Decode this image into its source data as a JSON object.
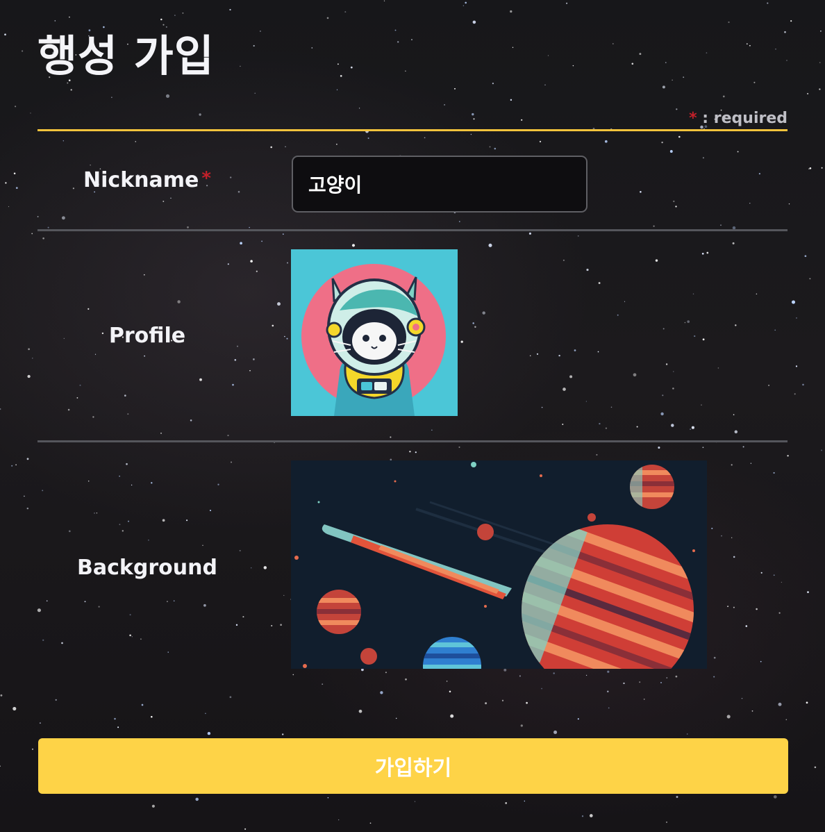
{
  "header": {
    "title": "행성 가입",
    "required_star": "*",
    "required_text": " : required"
  },
  "form": {
    "nickname": {
      "label": "Nickname",
      "required_star": "*",
      "value": "고양이"
    },
    "profile": {
      "label": "Profile",
      "image_icon": "astronaut-cat-icon"
    },
    "background": {
      "label": "Background",
      "image_icon": "space-planets-illustration"
    }
  },
  "submit": {
    "label": "가입하기"
  },
  "colors": {
    "accent_yellow": "#fed347",
    "divider_yellow": "#f3c33c",
    "required_red": "#c2202a",
    "input_background": "#0e0d10",
    "profile_background": "#4bc6d7",
    "illustration_background": "#111e2d"
  }
}
